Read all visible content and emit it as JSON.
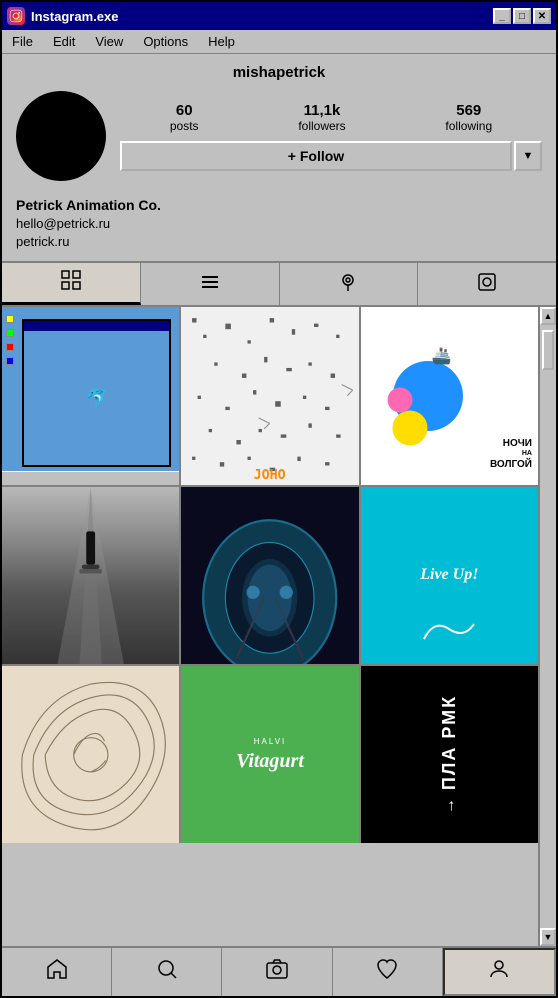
{
  "window": {
    "title": "Instagram.exe",
    "icon": "📷"
  },
  "title_buttons": {
    "minimize": "_",
    "maximize": "□",
    "close": "✕"
  },
  "menu": {
    "items": [
      "File",
      "Edit",
      "View",
      "Options",
      "Help"
    ]
  },
  "profile": {
    "username": "mishapetrick",
    "stats": {
      "posts": {
        "value": "60",
        "label": "posts"
      },
      "followers": {
        "value": "11,1k",
        "label": "followers"
      },
      "following": {
        "value": "569",
        "label": "following"
      }
    },
    "follow_button": "+ Follow",
    "dropdown_arrow": "▼",
    "bio_name": "Petrick Animation Co.",
    "bio_email": "hello@petrick.ru",
    "bio_website": "petrick.ru"
  },
  "tabs": {
    "items": [
      {
        "id": "grid",
        "icon": "⊞",
        "active": true
      },
      {
        "id": "list",
        "icon": "≡",
        "active": false
      },
      {
        "id": "location",
        "icon": "◎",
        "active": false
      },
      {
        "id": "tag",
        "icon": "⊡",
        "active": false
      }
    ]
  },
  "grid": {
    "cells": [
      {
        "id": 1,
        "type": "win95-desktop"
      },
      {
        "id": 2,
        "type": "pixel-art"
      },
      {
        "id": 3,
        "type": "nochi-volga"
      },
      {
        "id": 4,
        "type": "skateboard"
      },
      {
        "id": 5,
        "type": "metro"
      },
      {
        "id": 6,
        "type": "live-up"
      },
      {
        "id": 7,
        "type": "illustrated-bg"
      },
      {
        "id": 8,
        "type": "vitagurt"
      },
      {
        "id": 9,
        "type": "black-text"
      }
    ]
  },
  "nochi": {
    "text_line1": "НОЧИ",
    "text_sup": "НА",
    "text_line2": "ВОЛГОЙ"
  },
  "vitagurt": {
    "small": "HALVI",
    "big": "Vitagurt"
  },
  "black_cell": {
    "text": "ПЛА РМК",
    "arrow": "→"
  },
  "live_up": {
    "text": "Live Up!"
  },
  "bottom_nav": {
    "items": [
      {
        "id": "home",
        "icon": "⌂",
        "active": false
      },
      {
        "id": "search",
        "icon": "🔍",
        "active": false
      },
      {
        "id": "camera",
        "icon": "📷",
        "active": false
      },
      {
        "id": "heart",
        "icon": "♥",
        "active": false
      },
      {
        "id": "profile",
        "icon": "👤",
        "active": true
      }
    ]
  },
  "scrollbar": {
    "up_arrow": "▲",
    "down_arrow": "▼"
  }
}
